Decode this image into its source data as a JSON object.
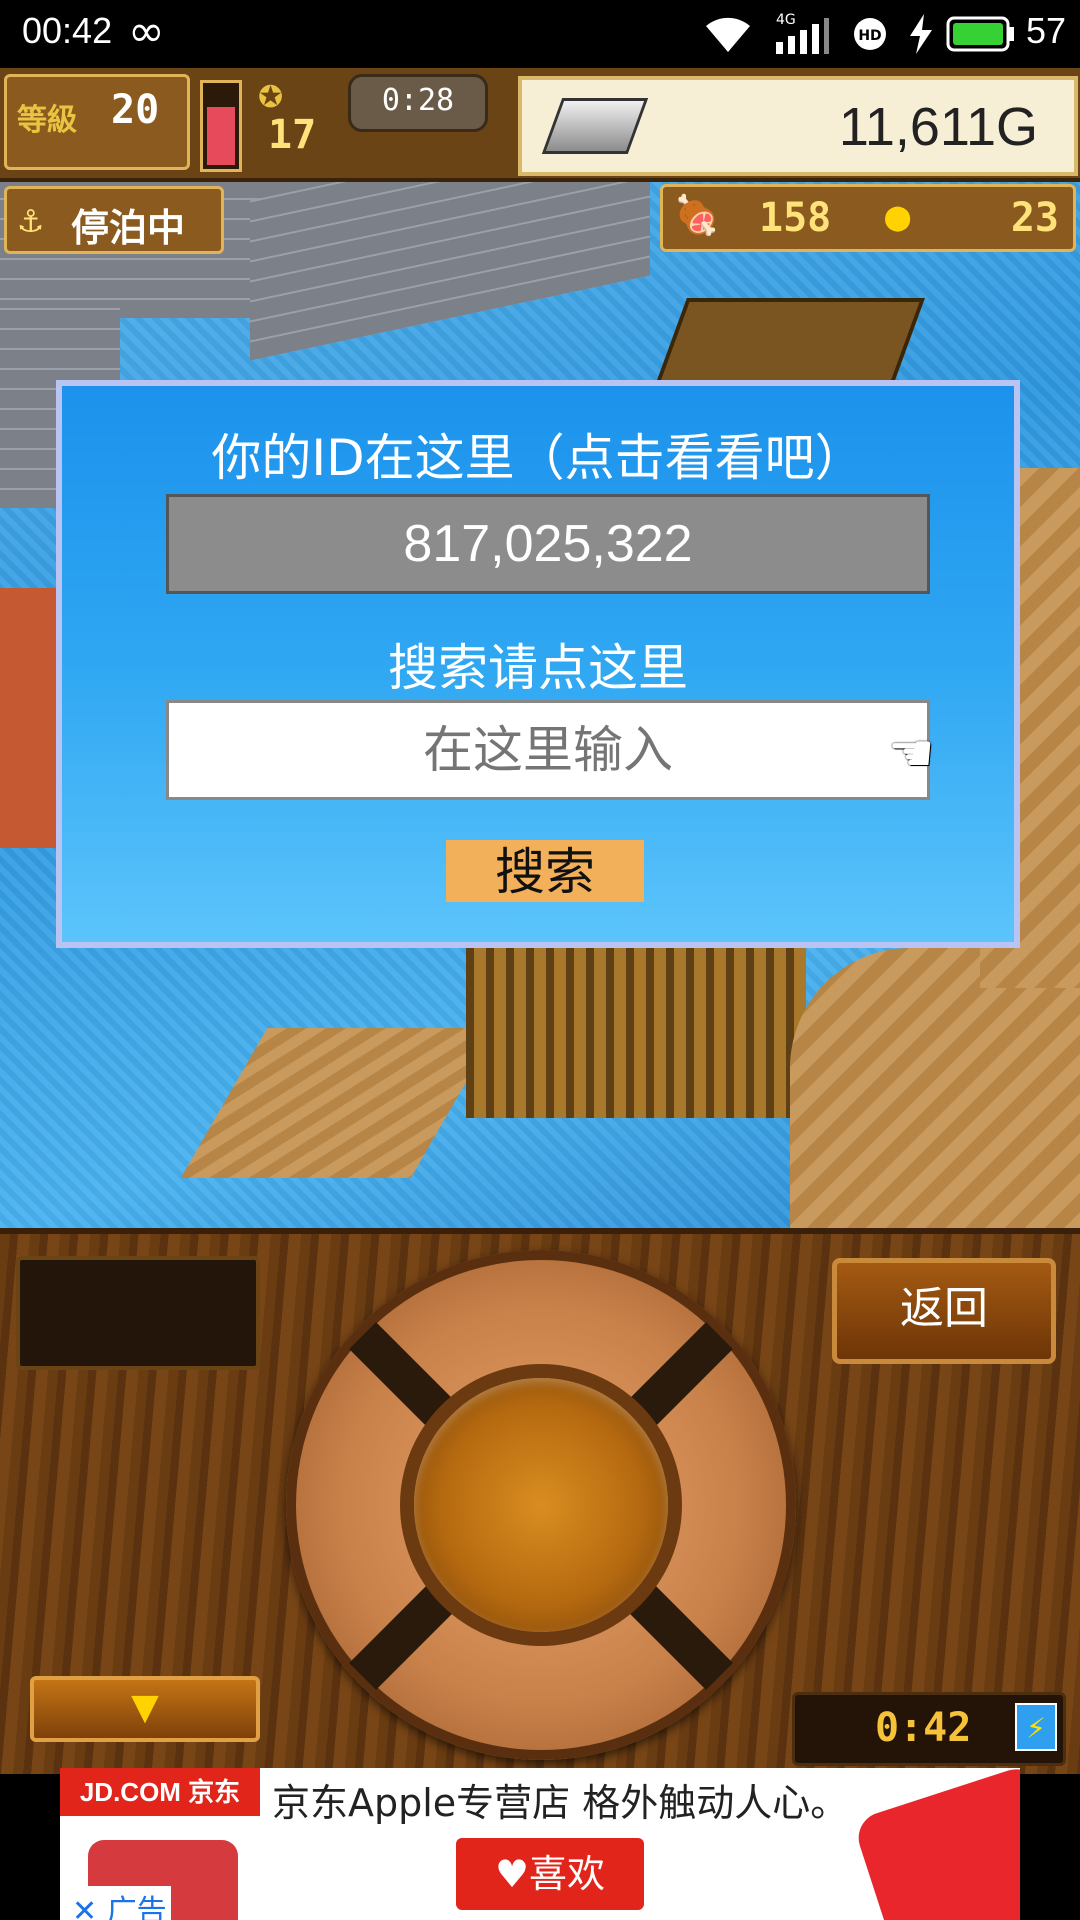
{
  "status_bar": {
    "time": "00:42",
    "loop_icon": "infinity-icon",
    "network": "4G",
    "battery": "57"
  },
  "hud": {
    "level_label": "等級",
    "level": "20",
    "stamina": "17",
    "timer": "0:28",
    "gold": "11,611G",
    "status": "停泊中",
    "food": "158",
    "coins": "23"
  },
  "dialog": {
    "title": "你的ID在这里（点击看看吧）",
    "id_value": "817,025,322",
    "search_hint": "搜索请点这里",
    "input_placeholder": "在这里输入",
    "search_button": "搜索"
  },
  "panel": {
    "back_button": "返回",
    "clock": "0:42"
  },
  "ad": {
    "brand": "JD.COM 京东",
    "headline": "京东Apple专营店 格外触动人心。",
    "like_button": "♥喜欢",
    "close": "✕",
    "ad_label": "广告"
  },
  "colors": {
    "dialog_bg": "#2fa7f2",
    "search_button_bg": "#f2b05a",
    "brand_red": "#e1251b"
  }
}
